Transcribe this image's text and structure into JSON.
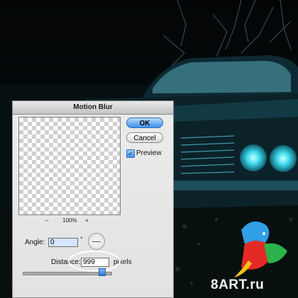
{
  "dialog": {
    "title": "Motion Blur",
    "ok_label": "OK",
    "cancel_label": "Cancel",
    "preview_label": "Preview",
    "preview_checked": true,
    "zoom_out": "–",
    "zoom_level": "100%",
    "zoom_in": "+",
    "angle_label": "Angle:",
    "angle_value": "0",
    "degree_symbol": "°",
    "distance_label": "Distance:",
    "distance_value": "999",
    "distance_unit": "pixels",
    "distance_slider_level": 0.92
  },
  "watermark": "8ART.ru",
  "colors": {
    "ok_button": "#3d8ff0",
    "headlight": "#34d4e8",
    "car_body": "#0d2a33"
  }
}
